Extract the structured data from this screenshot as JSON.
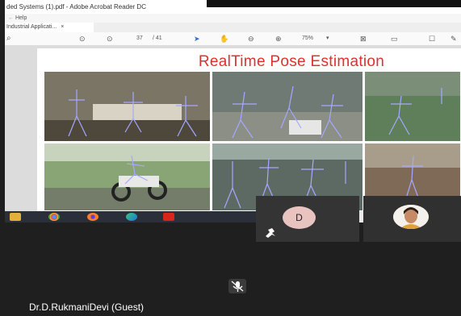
{
  "window": {
    "title": "ded Systems (1).pdf - Adobe Acrobat Reader DC",
    "menu_help": "Help",
    "tab_label": "Industrial Applicati...",
    "tab_close": "×"
  },
  "toolbar": {
    "page_current": "37",
    "page_total": "/ 41",
    "zoom": "75%"
  },
  "slide": {
    "title": "RealTime Pose Estimation"
  },
  "colors": {
    "title_red": "#e0302e",
    "pose_overlay": "#a6a8ff"
  },
  "taskbar": {
    "icons": [
      "file-explorer-icon",
      "chrome-icon",
      "firefox-icon",
      "edge-icon",
      "acrobat-icon"
    ]
  },
  "participants": [
    {
      "initial": "D",
      "icon": "pin-icon"
    },
    {
      "icon": "profile-photo"
    }
  ],
  "bottom": {
    "mic_icon": "mic-off-icon",
    "name": "Dr.D.RukmaniDevi (Guest)"
  }
}
